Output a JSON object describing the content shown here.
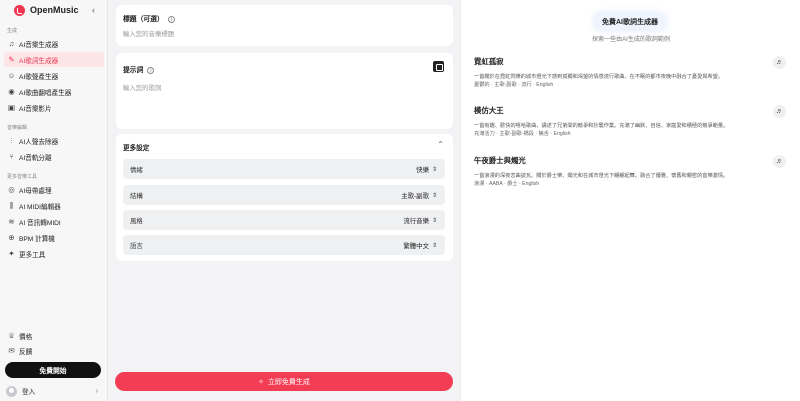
{
  "sidebar": {
    "brand": "OpenMusic",
    "sections": {
      "generate": "生成",
      "edit": "音樂編輯",
      "tools": "更多音樂工具"
    },
    "nav": [
      {
        "label": "AI音樂生成器",
        "icon": "music-note-icon"
      },
      {
        "label": "AI歌詞生成器",
        "icon": "lyrics-icon",
        "active": true
      },
      {
        "label": "AI歌聲產生器",
        "icon": "voice-icon"
      },
      {
        "label": "AI歌曲翻唱產生器",
        "icon": "cover-icon"
      },
      {
        "label": "AI音樂影片",
        "icon": "video-icon"
      },
      {
        "label": "AI人聲去除器",
        "icon": "vocal-remover-icon"
      },
      {
        "label": "AI音軌分離",
        "icon": "stem-split-icon"
      },
      {
        "label": "AI母帶處理",
        "icon": "mastering-icon"
      },
      {
        "label": "AI MIDI編輯器",
        "icon": "midi-icon"
      },
      {
        "label": "AI 音訊轉MIDI",
        "icon": "audio-to-midi-icon"
      },
      {
        "label": "BPM 計算機",
        "icon": "bpm-icon"
      },
      {
        "label": "更多工具",
        "icon": "more-tools-icon"
      }
    ],
    "pricing": "價格",
    "feedback": "反饋",
    "start_button": "免費開始",
    "login": "登入"
  },
  "form": {
    "title_label": "標題（可選）",
    "title_placeholder": "輸入您的音樂標題",
    "prompt_label": "提示詞",
    "prompt_placeholder": "輸入您的歌詞",
    "more_settings": "更多設定",
    "options": [
      {
        "label": "情緒",
        "value": "快樂"
      },
      {
        "label": "結構",
        "value": "主歌-副歌"
      },
      {
        "label": "風格",
        "value": "流行音樂"
      },
      {
        "label": "語言",
        "value": "繁體中文"
      }
    ],
    "generate_button": "立即免費生成"
  },
  "examples": {
    "badge": "免費AI歌詞生成器",
    "subtitle": "探索一些由AI生成的歌詞範例",
    "songs": [
      {
        "title": "霓虹孤寂",
        "desc": "一首關於在霓虹閃爍的城市燈光下感到孤獨和渴望的情感流行歌曲。在不眠的都市夜晚中融合了憂愛與希望。",
        "meta": "憂鬱的 · 主歌-副歌 · 流行 · English"
      },
      {
        "title": "模仿大王",
        "desc": "一首有趣、歡快的嘻哈歌曲，講述了兄弟間的競爭和抄襲作業。充滿了幽默、自信、家庭愛和積極的競爭範量。",
        "meta": "充滿活力 · 主歌-副歌-橋段 · 饒舌 · English"
      },
      {
        "title": "午夜爵士與燭光",
        "desc": "一首浪漫的深夜恋曲談瓦。關於爵士樂、燭光和在城市燈光下翩翩起舞。融合了優雅、懷舊和親密的音樂激情。",
        "meta": "浪漫 · AABA · 爵士 · English"
      }
    ]
  }
}
